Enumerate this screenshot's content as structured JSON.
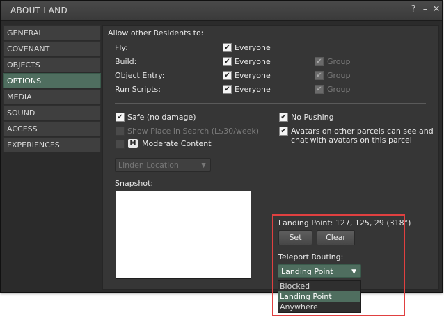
{
  "window": {
    "title": "ABOUT LAND",
    "help_glyph": "?",
    "minimize_glyph": "–",
    "close_glyph": "✕"
  },
  "tabs": [
    {
      "label": "GENERAL",
      "active": false
    },
    {
      "label": "COVENANT",
      "active": false
    },
    {
      "label": "OBJECTS",
      "active": false
    },
    {
      "label": "OPTIONS",
      "active": true
    },
    {
      "label": "MEDIA",
      "active": false
    },
    {
      "label": "SOUND",
      "active": false
    },
    {
      "label": "ACCESS",
      "active": false
    },
    {
      "label": "EXPERIENCES",
      "active": false
    }
  ],
  "options": {
    "allow_heading": "Allow other Residents to:",
    "permissions": [
      {
        "label": "Fly:",
        "everyone_label": "Everyone",
        "everyone_checked": true,
        "group_label": "",
        "group_checked": false
      },
      {
        "label": "Build:",
        "everyone_label": "Everyone",
        "everyone_checked": true,
        "group_label": "Group",
        "group_checked": true
      },
      {
        "label": "Object Entry:",
        "everyone_label": "Everyone",
        "everyone_checked": true,
        "group_label": "Group",
        "group_checked": true
      },
      {
        "label": "Run Scripts:",
        "everyone_label": "Everyone",
        "everyone_checked": true,
        "group_label": "Group",
        "group_checked": true
      }
    ],
    "safe_label": "Safe (no damage)",
    "safe_checked": true,
    "show_in_search_label": "Show Place in Search (L$30/week)",
    "show_in_search_checked": false,
    "moderate_badge": "M",
    "moderate_label": "Moderate Content",
    "moderate_checked": false,
    "no_pushing_label": "No Pushing",
    "no_pushing_checked": true,
    "avatars_see_label_line1": "Avatars on other parcels can see and",
    "avatars_see_label_line2": "chat with avatars on this parcel",
    "avatars_see_checked": true,
    "category_select": "Linden Location",
    "snapshot_label": "Snapshot:",
    "landing_point_text": "Landing Point: 127, 125, 29 (318°)",
    "set_button": "Set",
    "clear_button": "Clear",
    "teleport_routing_label": "Teleport Routing:",
    "teleport_routing_value": "Landing Point",
    "routing_options": [
      "Blocked",
      "Landing Point",
      "Anywhere"
    ],
    "routing_selected": "Landing Point"
  },
  "check_glyph": "✔",
  "colors": {
    "accent": "#4f6e5f",
    "highlight_box": "#e04040"
  }
}
